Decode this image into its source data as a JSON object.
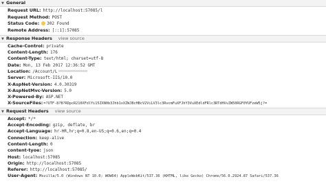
{
  "general": {
    "title": "General",
    "rows": [
      {
        "key": "Request URL:",
        "value": "http://localhost:57085/l"
      },
      {
        "key": "Request Method:",
        "value": "POST"
      },
      {
        "key": "Status Code:",
        "value": "302 Found"
      },
      {
        "key": "Remote Address:",
        "value": "[::1]:57085"
      }
    ]
  },
  "response_headers": {
    "title": "Response Headers",
    "view_source": "view source",
    "rows": [
      {
        "key": "Cache-Control:",
        "value": "private"
      },
      {
        "key": "Content-Length:",
        "value": "176"
      },
      {
        "key": "Content-Type:",
        "value": "text/html; charset=utf-8"
      },
      {
        "key": "Date:",
        "value": "Mon, 13 Feb 2017 12:36:52 GMT"
      },
      {
        "key": "Location:",
        "value": "/Account/L"
      },
      {
        "key": "Server:",
        "value": "Microsoft-IIS/10.0"
      },
      {
        "key": "X-AspNet-Version:",
        "value": "4.0.30319"
      },
      {
        "key": "X-AspNetMvc-Version:",
        "value": "5.0"
      },
      {
        "key": "X-Powered-By:",
        "value": "ASP.NET"
      },
      {
        "key": "X-SourceFiles:",
        "value": "=?UTF-8?B?RDpcR210XFdlYi15ZXN0b3Jhb1xXZWJBcHBcV2ViLV3lc3RvcmFuXFJhY3VuXEdldFRlc3RTdHVvZW50RGF0YUFzeW5j?="
      }
    ]
  },
  "request_headers": {
    "title": "Request Headers",
    "view_source": "view source",
    "rows": [
      {
        "key": "Accept:",
        "value": "*/*"
      },
      {
        "key": "Accept-Encoding:",
        "value": "gzip, deflate, br"
      },
      {
        "key": "Accept-Language:",
        "value": "hr-HR,hr;q=0.8,en-US;q=0.6,en;q=0.4"
      },
      {
        "key": "Connection:",
        "value": "keep-alive"
      },
      {
        "key": "Content-Length:",
        "value": "0"
      },
      {
        "key": "content-tyoe:",
        "value": "json"
      },
      {
        "key": "Host:",
        "value": "localhost:57085"
      },
      {
        "key": "Origin:",
        "value": "http://localhost:57085"
      },
      {
        "key": "Referer:",
        "value": "http://localhost:57085/"
      },
      {
        "key": "User-Agent:",
        "value": "Mozilla/5.0 (Windows NT 10.0; WOW64) AppleWebKit/537.36 (KHTML, like Gecko) Chrome/56.0.2924.87 Safari/537.36"
      }
    ]
  },
  "icons": {
    "collapse": "triangle-down-icon",
    "status": "status-dot-icon"
  },
  "colors": {
    "status_dot": "#f3c84c",
    "header_bg": "#f3f3f3",
    "view_source": "#6b6b6b"
  }
}
